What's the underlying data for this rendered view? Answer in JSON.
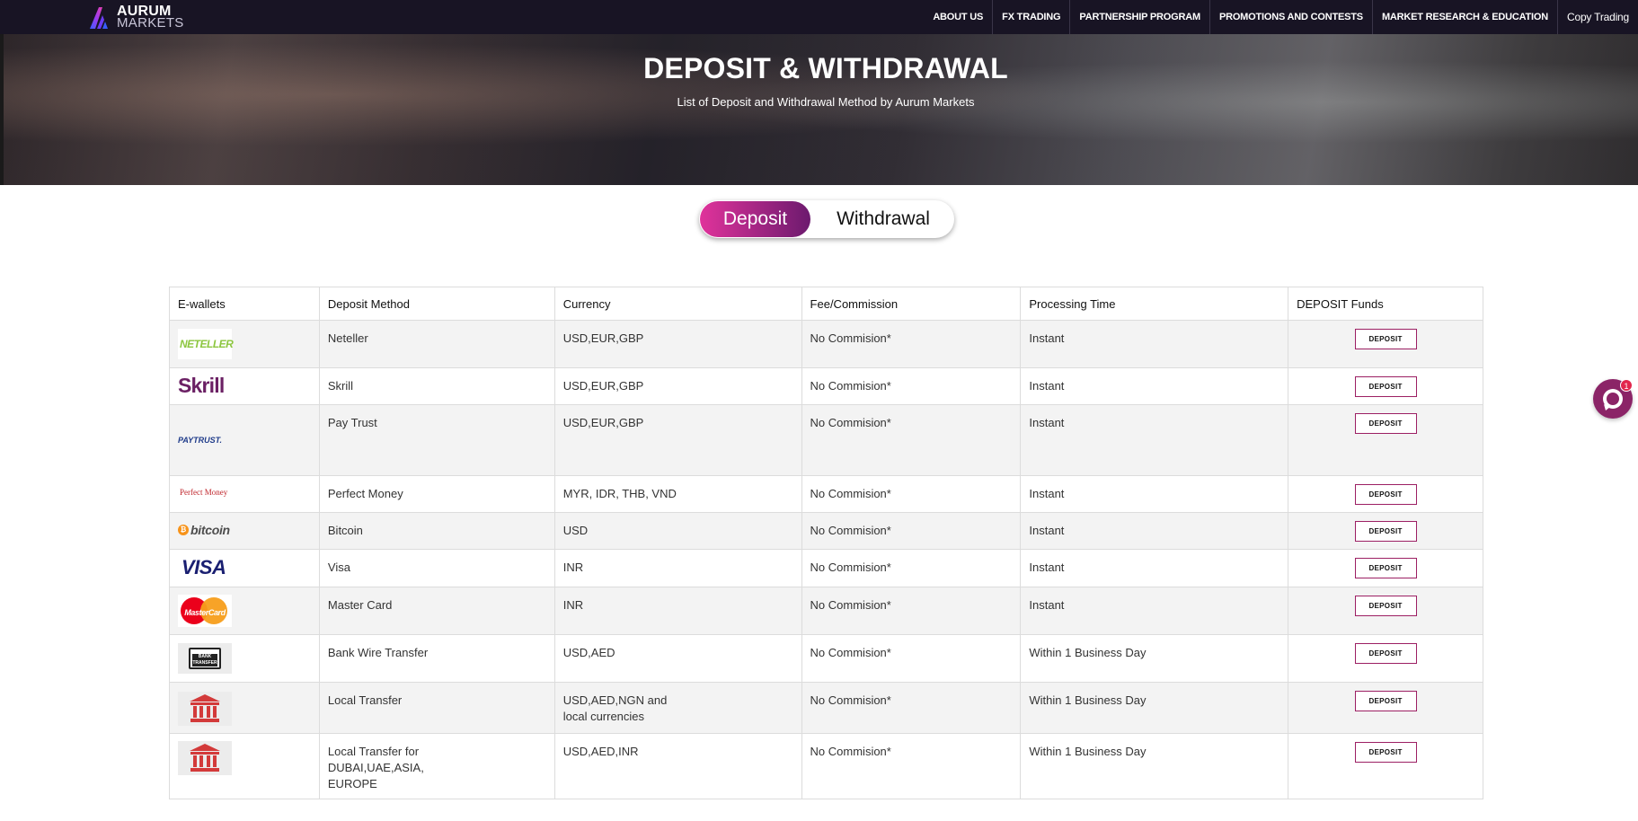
{
  "brand": {
    "line1": "AURUM",
    "line2": "MARKETS"
  },
  "nav": {
    "items": [
      {
        "label": "ABOUT US"
      },
      {
        "label": "FX TRADING"
      },
      {
        "label": "PARTNERSHIP PROGRAM"
      },
      {
        "label": "PROMOTIONS AND CONTESTS"
      },
      {
        "label": "MARKET RESEARCH & EDUCATION"
      },
      {
        "label": "Copy Trading"
      }
    ]
  },
  "hero": {
    "title": "DEPOSIT & WITHDRAWAL",
    "subtitle": "List of Deposit and Withdrawal Method by Aurum Markets"
  },
  "toggle": {
    "deposit": "Deposit",
    "withdrawal": "Withdrawal",
    "active": "Deposit"
  },
  "table": {
    "headers": [
      "E-wallets",
      "Deposit Method",
      "Currency",
      "Fee/Commission",
      "Processing Time",
      "DEPOSIT Funds"
    ],
    "button_label": "DEPOSIT",
    "rows": [
      {
        "logo": "NETELLER",
        "logo_icon": "neteller-logo",
        "method": "Neteller",
        "currency": "USD,EUR,GBP",
        "fee": "No Commision*",
        "time": "Instant"
      },
      {
        "logo": "Skrill",
        "logo_icon": "skrill-logo",
        "method": "Skrill",
        "currency": "USD,EUR,GBP",
        "fee": "No Commision*",
        "time": "Instant"
      },
      {
        "logo": "PAYTRUST.",
        "logo_icon": "paytrust-logo",
        "method": "Pay Trust",
        "currency": "USD,EUR,GBP",
        "fee": "No Commision*",
        "time": "Instant"
      },
      {
        "logo": "Perfect Money",
        "logo_icon": "perfect-money-logo",
        "method": "Perfect Money",
        "currency": "MYR, IDR, THB, VND",
        "fee": "No Commision*",
        "time": "Instant"
      },
      {
        "logo": "bitcoin",
        "logo_icon": "bitcoin-logo",
        "method": "Bitcoin",
        "currency": "USD",
        "fee": "No Commision*",
        "time": "Instant"
      },
      {
        "logo": "VISA",
        "logo_icon": "visa-logo",
        "method": "Visa",
        "currency": "INR",
        "fee": "No Commision*",
        "time": "Instant"
      },
      {
        "logo": "MasterCard",
        "logo_icon": "mastercard-logo",
        "method": "Master Card",
        "currency": "INR",
        "fee": "No Commision*",
        "time": "Instant"
      },
      {
        "logo": "BANK TRANSFER",
        "logo_icon": "bank-transfer-icon",
        "method": "Bank Wire Transfer",
        "currency": "USD,AED",
        "fee": "No Commision*",
        "time": "Within 1 Business Day"
      },
      {
        "logo": "",
        "logo_icon": "bank-building-icon",
        "method": "Local Transfer",
        "currency": "USD,AED,NGN and local currencies",
        "fee": "No Commision*",
        "time": "Within 1 Business Day"
      },
      {
        "logo": "",
        "logo_icon": "bank-building-icon",
        "method": "Local Transfer for DUBAI,UAE,ASIA, EUROPE",
        "currency": "USD,AED,INR",
        "fee": "No Commision*",
        "time": "Within 1 Business Day"
      }
    ]
  },
  "chat": {
    "badge": "1"
  },
  "colors": {
    "nav_bg": "#181424",
    "accent_pink": "#e0339b",
    "accent_purple": "#6c1a6e",
    "button_border": "#9c1f63",
    "bank_red": "#d33a3a"
  }
}
